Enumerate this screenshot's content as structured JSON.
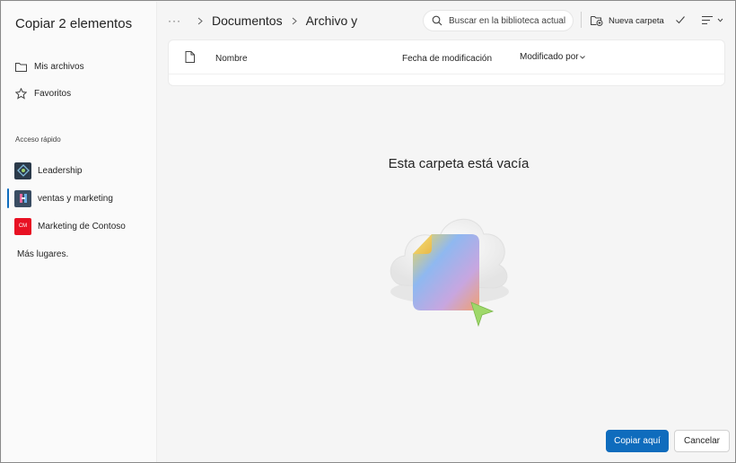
{
  "dialog": {
    "title": "Copiar 2 elementos"
  },
  "sidebar": {
    "nav": [
      {
        "label": "Mis archivos",
        "icon": "folder-icon"
      },
      {
        "label": "Favoritos",
        "icon": "star-icon"
      }
    ],
    "quick_access_label": "Acceso rápido",
    "sites": [
      {
        "label": "Leadership",
        "icon": "site-logo-leadership",
        "color": "#2b3a4a"
      },
      {
        "label": "ventas y marketing",
        "icon": "site-logo-sales",
        "color": "#3a4d63",
        "active": true
      },
      {
        "label": "Marketing de Contoso",
        "icon": "site-logo-contoso",
        "color": "#e81123",
        "badge": "CM"
      }
    ],
    "more_places": "Más lugares."
  },
  "header": {
    "ellipsis": "···",
    "breadcrumb": [
      "Documentos",
      "Archivo y"
    ],
    "search_placeholder": "Buscar en la biblioteca actual",
    "new_folder_label": "Nueva carpeta"
  },
  "list": {
    "columns": {
      "name": "Nombre",
      "modified": "Fecha de modificación",
      "modified_by": "Modificado por"
    }
  },
  "empty_state": {
    "title": "Esta carpeta está vacía"
  },
  "footer": {
    "primary_label": "Copiar aquí",
    "secondary_label": "Cancelar"
  },
  "colors": {
    "accent": "#0f6cbd",
    "contoso": "#e81123"
  }
}
